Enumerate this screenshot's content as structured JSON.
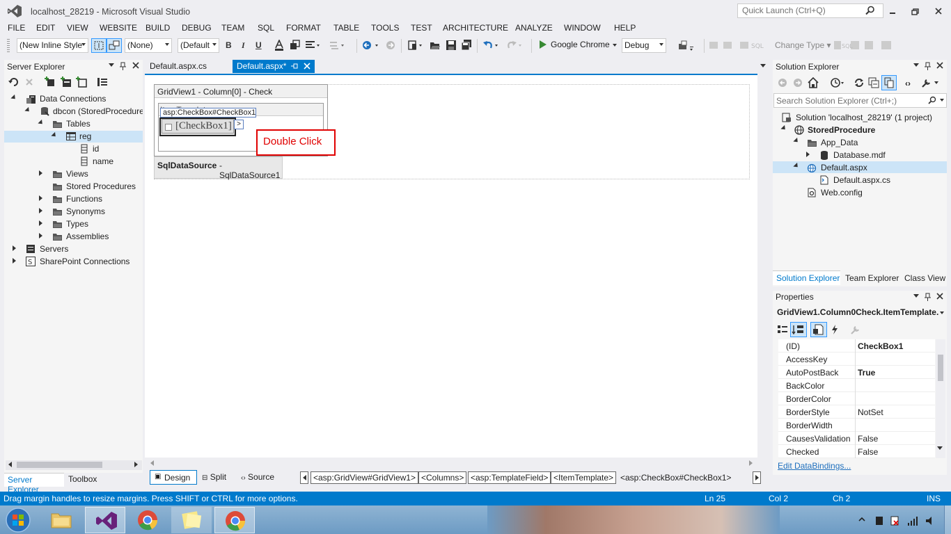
{
  "window": {
    "title": "localhost_28219 - Microsoft Visual Studio",
    "quick_launch_placeholder": "Quick Launch (Ctrl+Q)"
  },
  "menu": [
    "FILE",
    "EDIT",
    "VIEW",
    "WEBSITE",
    "BUILD",
    "DEBUG",
    "TEAM",
    "SQL",
    "FORMAT",
    "TABLE",
    "TOOLS",
    "TEST",
    "ARCHITECTURE",
    "ANALYZE",
    "WINDOW",
    "HELP"
  ],
  "toolbar": {
    "style_combo": "(New Inline Style",
    "target_combo": "(None)",
    "font_combo": "(Default",
    "bold": "B",
    "italic": "I",
    "underline": "U",
    "browser": "Google Chrome",
    "config": "Debug",
    "change_type": "Change Type"
  },
  "server_explorer": {
    "title": "Server Explorer",
    "items": [
      {
        "label": "Data Connections"
      },
      {
        "label": "dbcon (StoredProcedure"
      },
      {
        "label": "Tables"
      },
      {
        "label": "reg"
      },
      {
        "label": "id"
      },
      {
        "label": "name"
      },
      {
        "label": "Views"
      },
      {
        "label": "Stored Procedures"
      },
      {
        "label": "Functions"
      },
      {
        "label": "Synonyms"
      },
      {
        "label": "Types"
      },
      {
        "label": "Assemblies"
      },
      {
        "label": "Servers"
      },
      {
        "label": "SharePoint Connections"
      }
    ],
    "bottom_tabs": [
      "Server Explorer",
      "Toolbox"
    ]
  },
  "editor": {
    "tabs": [
      "Default.aspx.cs",
      "Default.aspx*"
    ],
    "gridview_header": "GridView1 - Column[0] - Check",
    "item_template_label": "ItemTemplate",
    "checkbox_tag": "asp:CheckBox#CheckBox1",
    "checkbox_text": "[CheckBox1]",
    "smart_tag": ">",
    "callout": "Double Click",
    "sqldatasource_bold": "SqlDataSource",
    "sqldatasource_rest": " - SqlDataSource1",
    "view_tabs": [
      "Design",
      "Split",
      "Source"
    ],
    "breadcrumbs": [
      "<asp:GridView#GridView1>",
      "<Columns>",
      "<asp:TemplateField>",
      "<ItemTemplate>",
      "<asp:CheckBox#CheckBox1>"
    ]
  },
  "solution_explorer": {
    "title": "Solution Explorer",
    "search_placeholder": "Search Solution Explorer (Ctrl+;)",
    "items": [
      {
        "label": "Solution 'localhost_28219' (1 project)"
      },
      {
        "label": "StoredProcedure"
      },
      {
        "label": "App_Data"
      },
      {
        "label": "Database.mdf"
      },
      {
        "label": "Default.aspx"
      },
      {
        "label": "Default.aspx.cs"
      },
      {
        "label": "Web.config"
      }
    ],
    "bottom_tabs": [
      "Solution Explorer",
      "Team Explorer",
      "Class View"
    ]
  },
  "properties": {
    "title": "Properties",
    "object": "GridView1.Column0Check.ItemTemplate.",
    "rows": [
      {
        "name": "(ID)",
        "value": "CheckBox1"
      },
      {
        "name": "AccessKey",
        "value": ""
      },
      {
        "name": "AutoPostBack",
        "value": "True"
      },
      {
        "name": "BackColor",
        "value": ""
      },
      {
        "name": "BorderColor",
        "value": ""
      },
      {
        "name": "BorderStyle",
        "value": "NotSet"
      },
      {
        "name": "BorderWidth",
        "value": ""
      },
      {
        "name": "CausesValidation",
        "value": "False"
      },
      {
        "name": "Checked",
        "value": "False"
      }
    ],
    "link": "Edit DataBindings..."
  },
  "statusbar": {
    "message": "Drag margin handles to resize margins. Press SHIFT or CTRL for more options.",
    "ln": "Ln 25",
    "col": "Col 2",
    "ch": "Ch 2",
    "mode": "INS"
  },
  "colors": {
    "accent": "#007acc",
    "callout_border": "#e00000"
  }
}
